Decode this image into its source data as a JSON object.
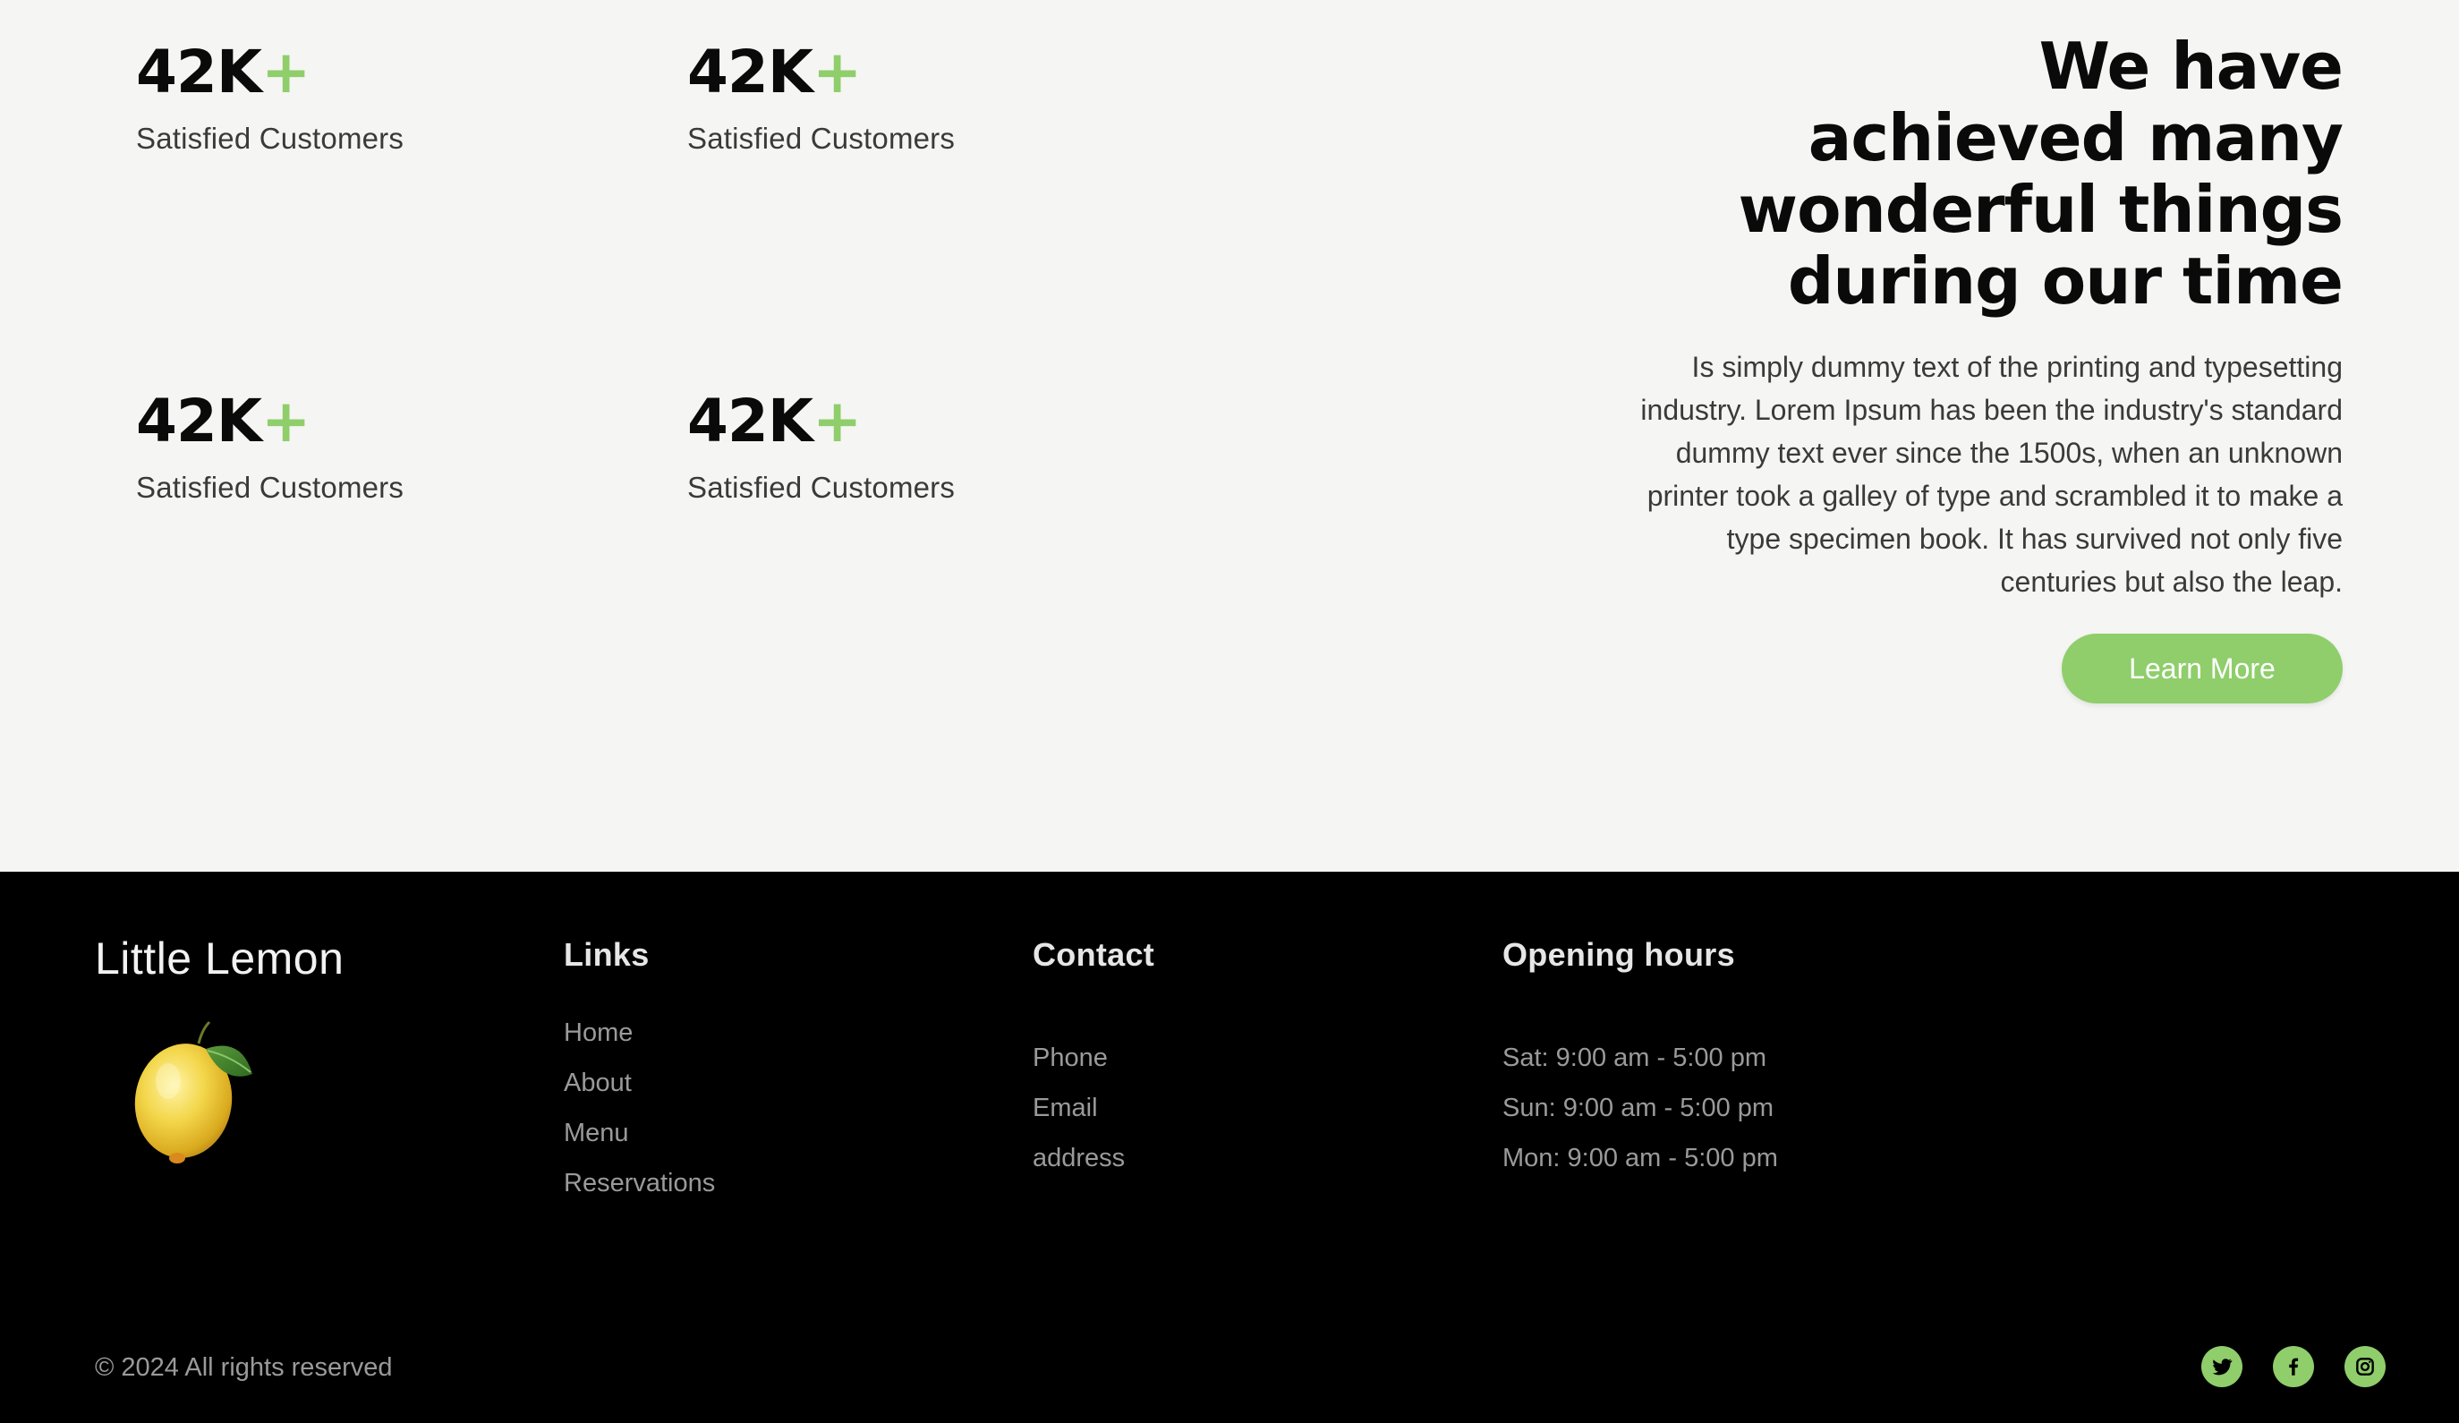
{
  "stats": [
    {
      "number": "42K",
      "suffix": "+",
      "label": "Satisfied Customers"
    },
    {
      "number": "42K",
      "suffix": "+",
      "label": "Satisfied Customers"
    },
    {
      "number": "42K",
      "suffix": "+",
      "label": "Satisfied Customers"
    },
    {
      "number": "42K",
      "suffix": "+",
      "label": "Satisfied Customers"
    }
  ],
  "achievement": {
    "title_lines": [
      "We have",
      "achieved many",
      "wonderful things",
      "during our time"
    ],
    "text_lines": [
      "Is simply dummy text of the printing and typesetting",
      "industry. Lorem Ipsum has been the industry's standard",
      "dummy text ever since the 1500s, when an unknown",
      "printer took a galley of type and scrambled it to make a",
      "type specimen book. It has survived not only five",
      "centuries but also the leap."
    ],
    "button_label": "Learn More"
  },
  "footer": {
    "brand": "Little Lemon",
    "links": {
      "heading": "Links",
      "items": [
        "Home",
        "About",
        "Menu",
        "Reservations"
      ]
    },
    "contact": {
      "heading": "Contact",
      "items": [
        "Phone",
        "Email",
        "address"
      ]
    },
    "hours": {
      "heading": "Opening hours",
      "items": [
        "Sat: 9:00 am - 5:00 pm",
        "Sun: 9:00 am - 5:00 pm",
        "Mon: 9:00 am - 5:00 pm"
      ]
    },
    "copyright": "© 2024 All rights reserved",
    "socials": [
      "twitter-icon",
      "facebook-icon",
      "instagram-icon"
    ]
  },
  "colors": {
    "accent": "#8fce6b",
    "page_bg": "#f5f5f3",
    "footer_bg": "#000000",
    "text_dark": "#0a0a0a",
    "text_muted": "#9a9a9a"
  }
}
